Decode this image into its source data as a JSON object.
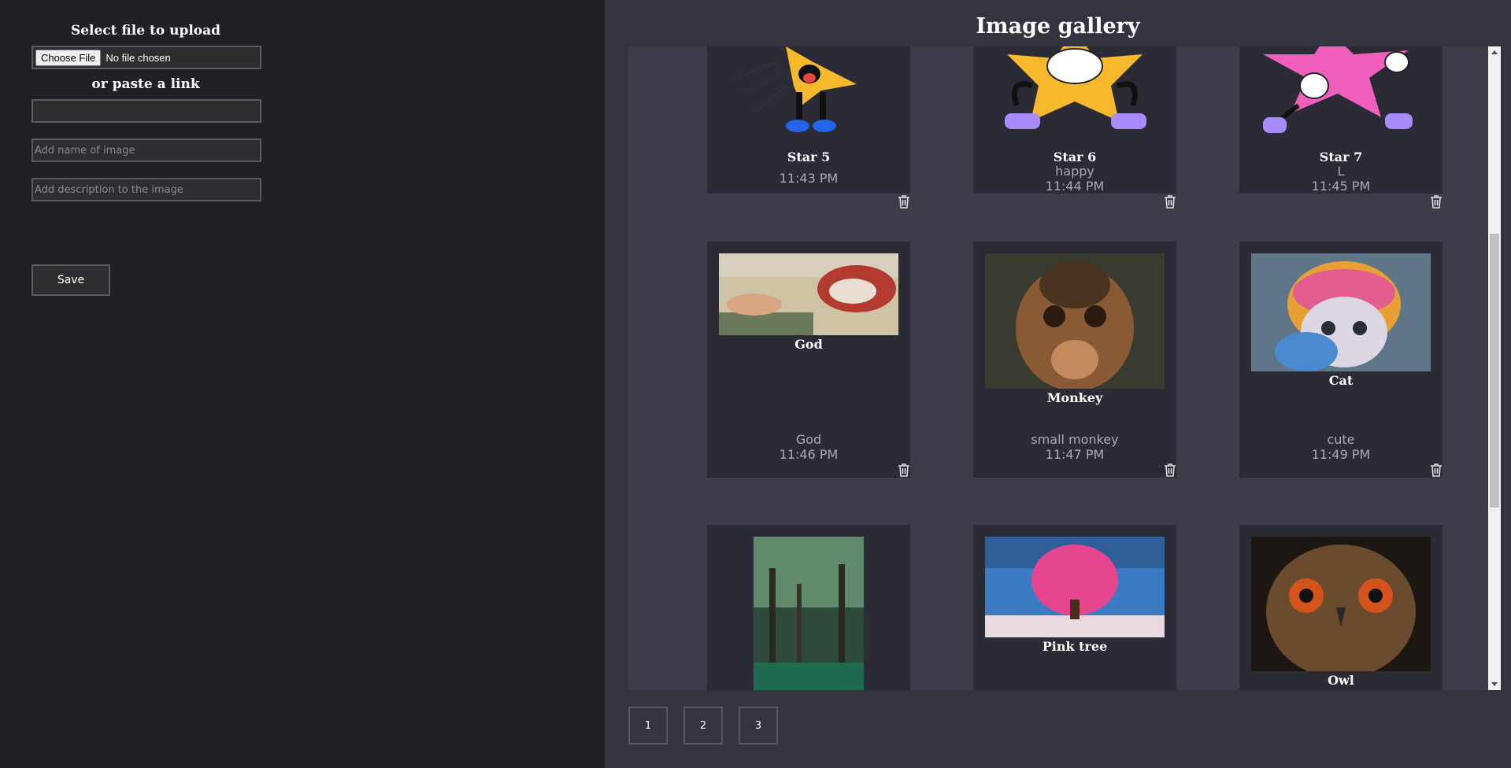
{
  "upload": {
    "select_label": "Select file to upload",
    "choose_file_label": "Choose File",
    "no_file_text": "No file chosen",
    "or_paste_label": "or paste a link",
    "link_value": "",
    "name_placeholder": "Add name of image",
    "description_placeholder": "Add description to the image",
    "save_label": "Save"
  },
  "gallery": {
    "title": "Image gallery",
    "cards": [
      {
        "name": "Star 5",
        "description": "",
        "time": "11:43 PM"
      },
      {
        "name": "Star 6",
        "description": "happy",
        "time": "11:44 PM"
      },
      {
        "name": "Star 7",
        "description": "L",
        "time": "11:45 PM"
      },
      {
        "name": "God",
        "description": "God",
        "time": "11:46 PM"
      },
      {
        "name": "Monkey",
        "description": "small monkey",
        "time": "11:47 PM"
      },
      {
        "name": "Cat",
        "description": "cute",
        "time": "11:49 PM"
      },
      {
        "name": "",
        "description": "",
        "time": ""
      },
      {
        "name": "Pink tree",
        "description": "",
        "time": ""
      },
      {
        "name": "Owl",
        "description": "",
        "time": ""
      }
    ]
  },
  "pagination": [
    "1",
    "2",
    "3"
  ],
  "colors": {
    "left_bg": "#202124",
    "gallery_bg": "#34343f",
    "card_bg": "#2b2b35",
    "viewport_bg": "#3d3d4a",
    "input_border": "#5a5b5e"
  },
  "icons": {
    "delete": "trash-icon",
    "scroll_up": "chevron-up-icon",
    "scroll_down": "chevron-down-icon"
  }
}
